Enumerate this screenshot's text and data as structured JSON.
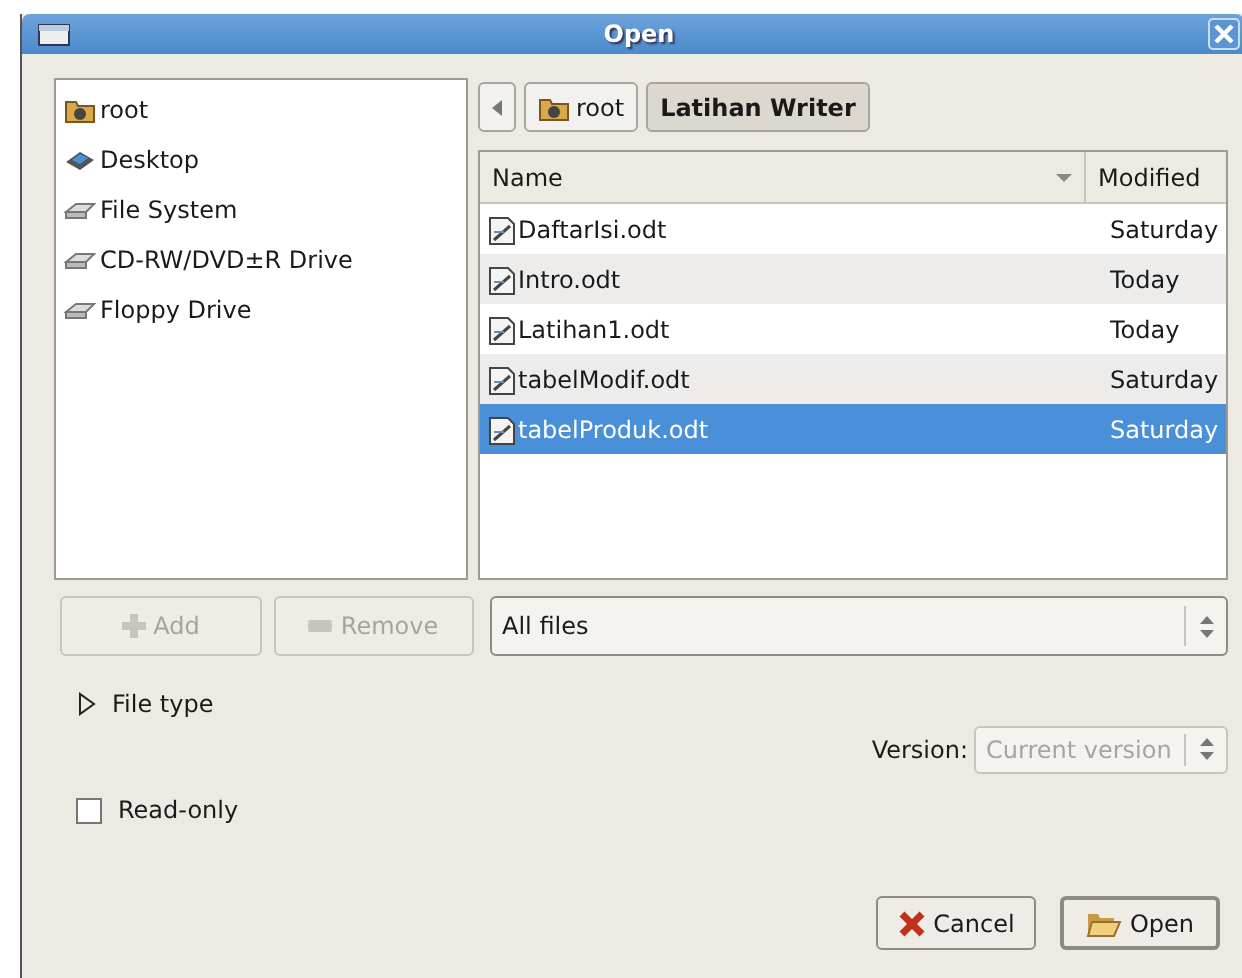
{
  "window": {
    "title": "Open"
  },
  "places": [
    {
      "label": "root",
      "kind": "home",
      "selected": false
    },
    {
      "label": "Desktop",
      "kind": "desktop",
      "selected": false
    },
    {
      "label": "File System",
      "kind": "drive",
      "selected": false
    },
    {
      "label": "CD-RW/DVD±R Drive",
      "kind": "drive",
      "selected": false
    },
    {
      "label": "Floppy Drive",
      "kind": "drive",
      "selected": false
    }
  ],
  "path_bar": [
    {
      "label": "root",
      "kind": "home",
      "selected": false
    },
    {
      "label": "Latihan Writer",
      "kind": "folder",
      "selected": true
    }
  ],
  "table": {
    "columns": [
      "Name",
      "Modified"
    ],
    "rows": [
      {
        "name": "DaftarIsi.odt",
        "modified": "Saturday",
        "selected": false
      },
      {
        "name": "Intro.odt",
        "modified": "Today",
        "selected": false
      },
      {
        "name": "Latihan1.odt",
        "modified": "Today",
        "selected": false
      },
      {
        "name": "tabelModif.odt",
        "modified": "Saturday",
        "selected": false
      },
      {
        "name": "tabelProduk.odt",
        "modified": "Saturday",
        "selected": true
      }
    ]
  },
  "place_buttons": [
    {
      "label": "Add",
      "kind": "add",
      "disabled": true
    },
    {
      "label": "Remove",
      "kind": "remove",
      "disabled": true
    }
  ],
  "filter": {
    "value": "All files"
  },
  "file_type": {
    "label": "File type",
    "expanded": false
  },
  "version": {
    "label": "Version:",
    "value": "Current version",
    "disabled": true
  },
  "read_only": {
    "label": "Read-only",
    "checked": false
  },
  "buttons": [
    {
      "label": "Cancel",
      "kind": "cancel"
    },
    {
      "label": "Open",
      "kind": "open"
    }
  ]
}
